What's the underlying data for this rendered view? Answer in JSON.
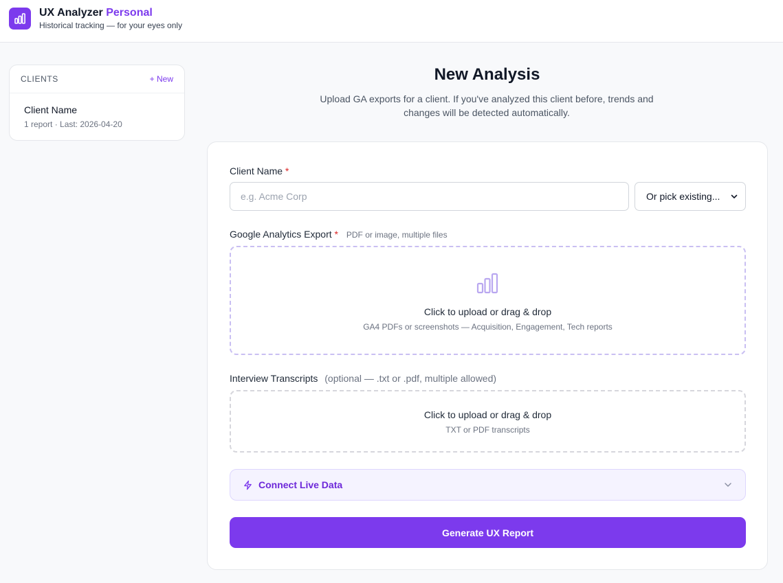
{
  "header": {
    "app_name": "UX Analyzer",
    "app_name_accent": "Personal",
    "subtitle": "Historical tracking — for your eyes only"
  },
  "sidebar": {
    "section_label": "CLIENTS",
    "new_label": "+ New",
    "clients": [
      {
        "name": "Client Name",
        "meta": "1 report · Last: 2026-04-20"
      }
    ]
  },
  "main": {
    "title": "New Analysis",
    "description": "Upload GA exports for a client. If you've analyzed this client before, trends and changes will be detected automatically."
  },
  "form": {
    "client_name_label": "Client Name",
    "required_mark": "*",
    "client_name_placeholder": "e.g. Acme Corp",
    "client_name_value": "",
    "pick_existing_label": "Or pick existing...",
    "ga_label": "Google Analytics Export",
    "ga_hint": "PDF or image, multiple files",
    "ga_dropzone_title": "Click to upload or drag & drop",
    "ga_dropzone_sub": "GA4 PDFs or screenshots — Acquisition, Engagement, Tech reports",
    "transcripts_label": "Interview Transcripts",
    "transcripts_hint": "(optional — .txt or .pdf, multiple allowed)",
    "transcripts_dropzone_title": "Click to upload or drag & drop",
    "transcripts_dropzone_sub": "TXT or PDF transcripts",
    "connect_label": "Connect Live Data",
    "generate_label": "Generate UX Report"
  },
  "icons": {
    "logo": "bar-chart-icon",
    "upload": "bar-chart-icon",
    "connect": "lightning-icon",
    "expand": "chevron-down-icon",
    "select": "chevron-down-icon"
  },
  "colors": {
    "accent": "#7c3aed",
    "required": "#dc2626",
    "background": "#f8f9fb"
  }
}
